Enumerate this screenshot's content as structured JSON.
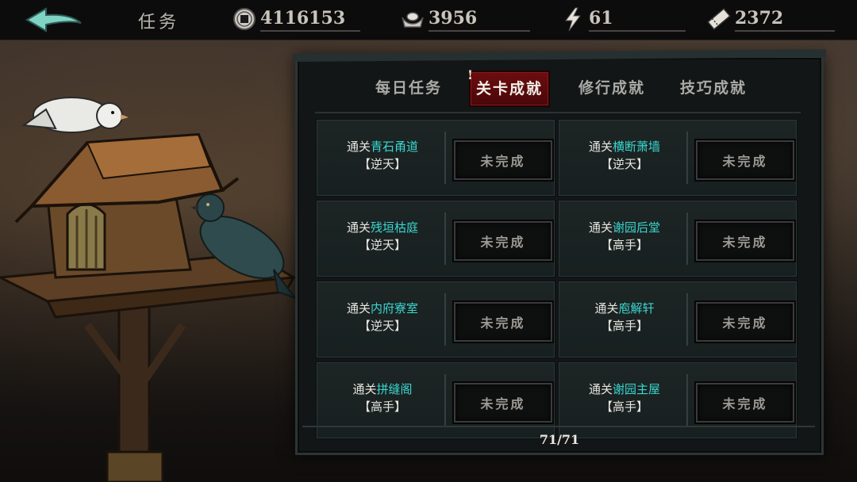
{
  "header": {
    "title": "任务",
    "resources": [
      {
        "icon": "coin-icon",
        "value": "4116153"
      },
      {
        "icon": "silver-ingot-icon",
        "value": "3956"
      },
      {
        "icon": "lightning-icon",
        "value": "61"
      },
      {
        "icon": "ticket-icon",
        "value": "2372"
      }
    ]
  },
  "tabs": {
    "items": [
      {
        "label": "每日任务",
        "active": false
      },
      {
        "label": "关卡成就",
        "active": true
      },
      {
        "label": "修行成就",
        "active": false
      },
      {
        "label": "技巧成就",
        "active": false
      }
    ],
    "alert": "!"
  },
  "achievements": [
    {
      "prefix": "通关",
      "name": "青石甬道",
      "difficulty": "【逆天】",
      "status": "未完成"
    },
    {
      "prefix": "通关",
      "name": "横断萧墙",
      "difficulty": "【逆天】",
      "status": "未完成"
    },
    {
      "prefix": "通关",
      "name": "残垣枯庭",
      "difficulty": "【逆天】",
      "status": "未完成"
    },
    {
      "prefix": "通关",
      "name": "谢园后堂",
      "difficulty": "【高手】",
      "status": "未完成"
    },
    {
      "prefix": "通关",
      "name": "内府寮室",
      "difficulty": "【逆天】",
      "status": "未完成"
    },
    {
      "prefix": "通关",
      "name": "庖解轩",
      "difficulty": "【高手】",
      "status": "未完成"
    },
    {
      "prefix": "通关",
      "name": "拼缝阁",
      "difficulty": "【高手】",
      "status": "未完成"
    },
    {
      "prefix": "通关",
      "name": "谢园主屋",
      "difficulty": "【高手】",
      "status": "未完成"
    }
  ],
  "pagination": {
    "text": "71/71"
  },
  "colors": {
    "highlight": "#3ad7d0",
    "active_tab": "#6b0d10",
    "back_arrow": "#7fd3c5"
  }
}
